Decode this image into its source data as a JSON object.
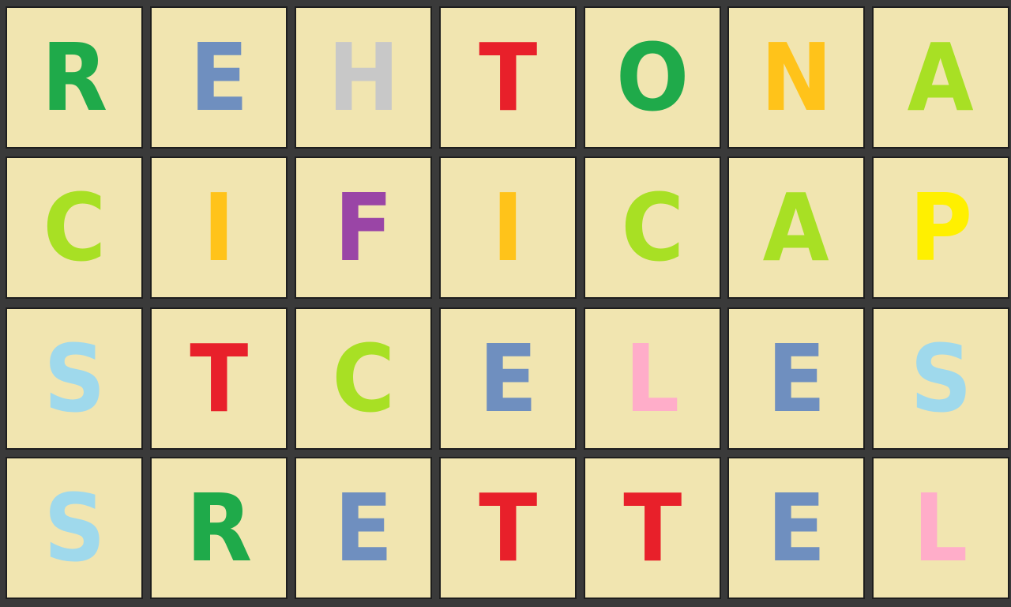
{
  "colors": {
    "board_background": "#3a3a3a",
    "tile_background": "#f1e5b0",
    "tile_border": "#1e1e1e"
  },
  "grid": {
    "rows": [
      [
        {
          "letter": "R",
          "color": "#1faa4a"
        },
        {
          "letter": "E",
          "color": "#6f8fbf"
        },
        {
          "letter": "H",
          "color": "#c8c8c8"
        },
        {
          "letter": "T",
          "color": "#e8202a"
        },
        {
          "letter": "O",
          "color": "#1faa4a"
        },
        {
          "letter": "N",
          "color": "#ffc31a"
        },
        {
          "letter": "A",
          "color": "#a8e024"
        }
      ],
      [
        {
          "letter": "C",
          "color": "#a8e024"
        },
        {
          "letter": "I",
          "color": "#ffc31a"
        },
        {
          "letter": "F",
          "color": "#9a45a6"
        },
        {
          "letter": "I",
          "color": "#ffc31a"
        },
        {
          "letter": "C",
          "color": "#a8e024"
        },
        {
          "letter": "A",
          "color": "#a8e024"
        },
        {
          "letter": "P",
          "color": "#fff000"
        }
      ],
      [
        {
          "letter": "S",
          "color": "#9fd9ec"
        },
        {
          "letter": "T",
          "color": "#e8202a"
        },
        {
          "letter": "C",
          "color": "#a8e024"
        },
        {
          "letter": "E",
          "color": "#6f8fbf"
        },
        {
          "letter": "L",
          "color": "#ffadc9"
        },
        {
          "letter": "E",
          "color": "#6f8fbf"
        },
        {
          "letter": "S",
          "color": "#9fd9ec"
        }
      ],
      [
        {
          "letter": "S",
          "color": "#9fd9ec"
        },
        {
          "letter": "R",
          "color": "#1faa4a"
        },
        {
          "letter": "E",
          "color": "#6f8fbf"
        },
        {
          "letter": "T",
          "color": "#e8202a"
        },
        {
          "letter": "T",
          "color": "#e8202a"
        },
        {
          "letter": "E",
          "color": "#6f8fbf"
        },
        {
          "letter": "L",
          "color": "#ffadc9"
        }
      ]
    ]
  }
}
